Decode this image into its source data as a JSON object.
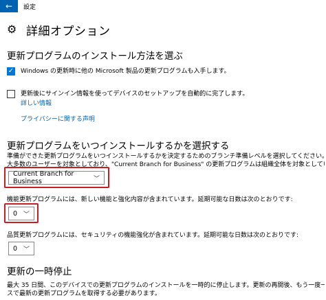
{
  "window": {
    "title": "設定",
    "back_glyph": "←"
  },
  "page": {
    "title": "詳細オプション",
    "gear_glyph": "⚙"
  },
  "section_install": {
    "heading": "更新プログラムのインストール方法を選ぶ",
    "checkbox1": {
      "label": "Windows の更新時に他の Microsoft 製品の更新プログラムも入手します。",
      "checked": true
    },
    "checkbox2": {
      "label": "更新後にサインイン情報を使ってデバイスのセットアップを自動的に完了します。",
      "checked": false
    },
    "details_link": "詳しい情報",
    "privacy_link": "プライバシーに関する声明"
  },
  "section_when": {
    "heading": "更新プログラムをいつインストールするかを選択する",
    "desc_line1": "準備ができた更新プログラムをいつインストールするかを決定するためのブランチ準備レベルを選択してください。\"Current Branch\" の更新プログラムは",
    "desc_line2": "大多数のユーザーを対象としており、\"Current Branch for Business\" の更新プログラムは組織全体を対象としています。",
    "branch_select": "Current Branch for Business",
    "feature_label": "機能更新プログラムには、新しい機能と強化内容が含まれています。延期可能な日数は次のとおりです:",
    "feature_days": "0",
    "quality_label": "品質更新プログラムには、セキュリティの機能強化が含まれています。延期可能な日数は次のとおりです:",
    "quality_days": "0"
  },
  "section_pause": {
    "heading": "更新の一時停止",
    "desc_line1": "最大 35 日間、このデバイスでの更新プログラムのインストールを一時的に停止します。更新の再開後、もう一度一時停止するには、このデバイ",
    "desc_line2": "スで最新の更新プログラムを取得する必要があります。"
  },
  "colors": {
    "accent": "#0063b1",
    "checkbox": "#0078d7",
    "highlight": "#c81d25"
  },
  "icons": {
    "back": "back-arrow-icon",
    "settings": "gear-icon",
    "check": "checkmark-icon",
    "dropdown": "chevron-down-icon"
  }
}
